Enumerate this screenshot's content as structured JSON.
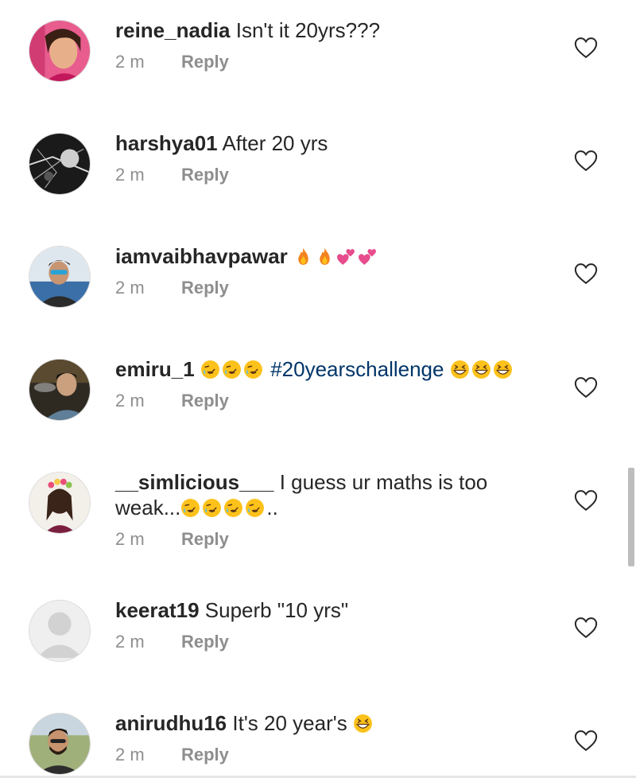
{
  "comments": [
    {
      "username": "reine_nadia",
      "text": "Isn't it 20yrs???",
      "time": "2 m",
      "reply_label": "Reply",
      "avatar_icon": "user-avatar-photo"
    },
    {
      "username": "harshya01",
      "text": "After 20 yrs",
      "time": "2 m",
      "reply_label": "Reply",
      "avatar_icon": "user-avatar-photo"
    },
    {
      "username": "iamvaibhavpawar",
      "emojis": [
        "fire-emoji",
        "fire-emoji",
        "two-hearts-emoji",
        "two-hearts-emoji"
      ],
      "time": "2 m",
      "reply_label": "Reply",
      "avatar_icon": "user-avatar-photo"
    },
    {
      "username": "emiru_1",
      "hashtag": "#20yearschallenge",
      "emojis_before": [
        "rofl-emoji",
        "rofl-emoji",
        "rofl-emoji"
      ],
      "emojis_after": [
        "grinning-squinting-emoji",
        "grinning-squinting-emoji",
        "grinning-squinting-emoji"
      ],
      "time": "2 m",
      "reply_label": "Reply",
      "avatar_icon": "user-avatar-photo"
    },
    {
      "username": "__simlicious___",
      "text": "I guess ur maths is too",
      "text_line2": "weak...",
      "text_tail": "..",
      "emojis": [
        "rofl-emoji",
        "rofl-emoji",
        "rofl-emoji",
        "rofl-emoji"
      ],
      "time": "2 m",
      "reply_label": "Reply",
      "avatar_icon": "user-avatar-photo"
    },
    {
      "username": "keerat19",
      "text": "Superb \"10 yrs\"",
      "time": "2 m",
      "reply_label": "Reply",
      "avatar_icon": "default-avatar-icon"
    },
    {
      "username": "anirudhu16",
      "text": "It's 20 year's",
      "emojis": [
        "grinning-squinting-emoji"
      ],
      "time": "2 m",
      "reply_label": "Reply",
      "avatar_icon": "user-avatar-photo"
    }
  ],
  "icons": {
    "like": "heart-outline-icon"
  },
  "colors": {
    "text": "#262626",
    "meta": "#8e8e8e",
    "hashtag": "#003569",
    "border": "#dbdbdb"
  }
}
